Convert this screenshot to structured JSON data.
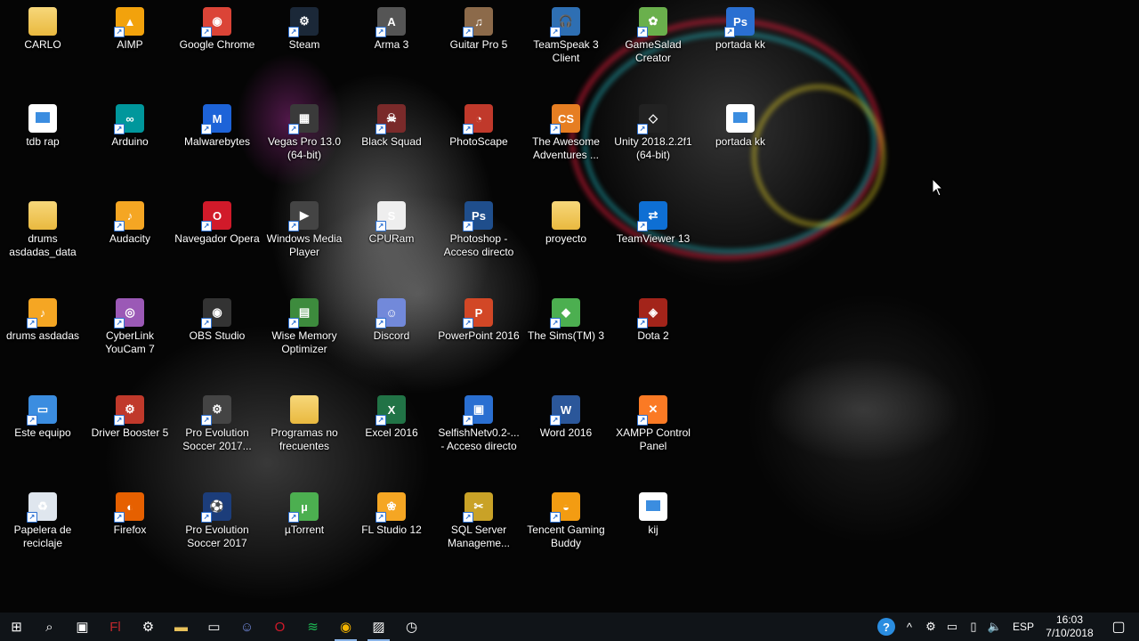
{
  "desktop": {
    "icons": [
      {
        "label": "CARLO",
        "name": "carlo-folder-icon",
        "color": "#e8c15a",
        "kind": "folder"
      },
      {
        "label": "AIMP",
        "name": "aimp-icon",
        "color": "#f2a20c",
        "kind": "app",
        "glyph": "▲"
      },
      {
        "label": "Google Chrome",
        "name": "google-chrome-icon",
        "color": "#db4437",
        "kind": "app",
        "glyph": "◉"
      },
      {
        "label": "Steam",
        "name": "steam-icon",
        "color": "#1b2838",
        "kind": "app",
        "glyph": "⚙"
      },
      {
        "label": "Arma 3",
        "name": "arma-3-icon",
        "color": "#555555",
        "kind": "app",
        "glyph": "A"
      },
      {
        "label": "Guitar Pro 5",
        "name": "guitar-pro-5-icon",
        "color": "#8c6a4a",
        "kind": "app",
        "glyph": "♫"
      },
      {
        "label": "TeamSpeak 3 Client",
        "name": "teamspeak-3-client-icon",
        "color": "#2e6fb3",
        "kind": "app",
        "glyph": "🎧"
      },
      {
        "label": "GameSalad Creator",
        "name": "gamesalad-creator-icon",
        "color": "#6ab04c",
        "kind": "app",
        "glyph": "✿"
      },
      {
        "label": "portada kk",
        "name": "portada-kk-psd-icon",
        "color": "#2a6fd1",
        "kind": "app",
        "glyph": "Ps"
      },
      {
        "label": "tdb rap",
        "name": "tdb-rap-file-icon",
        "color": "#ffffff",
        "kind": "file"
      },
      {
        "label": "Arduino",
        "name": "arduino-icon",
        "color": "#00979c",
        "kind": "app",
        "glyph": "∞"
      },
      {
        "label": "Malwarebytes",
        "name": "malwarebytes-icon",
        "color": "#1d63d8",
        "kind": "app",
        "glyph": "M"
      },
      {
        "label": "Vegas Pro 13.0\n(64-bit)",
        "name": "vegas-pro-icon",
        "color": "#3a3a3a",
        "kind": "app",
        "glyph": "▦"
      },
      {
        "label": "Black Squad",
        "name": "black-squad-icon",
        "color": "#7a2a2a",
        "kind": "app",
        "glyph": "☠"
      },
      {
        "label": "PhotoScape",
        "name": "photoscape-icon",
        "color": "#c0392b",
        "kind": "app",
        "glyph": "◔"
      },
      {
        "label": "The Awesome\nAdventures ...",
        "name": "awesome-adventures-icon",
        "color": "#e67e22",
        "kind": "app",
        "glyph": "CS"
      },
      {
        "label": "Unity 2018.2.2f1\n(64-bit)",
        "name": "unity-icon",
        "color": "#222222",
        "kind": "app",
        "glyph": "◇"
      },
      {
        "label": "portada kk",
        "name": "portada-kk-image-icon",
        "color": "#ffffff",
        "kind": "file"
      },
      {
        "label": "drums\nasdadas_data",
        "name": "drums-asdadas-data-folder-icon",
        "color": "#e8c15a",
        "kind": "folder"
      },
      {
        "label": "Audacity",
        "name": "audacity-icon",
        "color": "#f5a623",
        "kind": "app",
        "glyph": "♪"
      },
      {
        "label": "Navegador Opera",
        "name": "opera-icon",
        "color": "#d11a2a",
        "kind": "app",
        "glyph": "O"
      },
      {
        "label": "Windows Media\nPlayer",
        "name": "windows-media-player-icon",
        "color": "#444444",
        "kind": "app",
        "glyph": "▶"
      },
      {
        "label": "CPURam",
        "name": "cpuram-icon",
        "color": "#eeeeee",
        "kind": "app",
        "glyph": "S"
      },
      {
        "label": "Photoshop -\nAcceso directo",
        "name": "photoshop-icon",
        "color": "#1f4e8c",
        "kind": "app",
        "glyph": "Ps"
      },
      {
        "label": "proyecto",
        "name": "proyecto-folder-icon",
        "color": "#e8c15a",
        "kind": "folder"
      },
      {
        "label": "TeamViewer 13",
        "name": "teamviewer-icon",
        "color": "#0e6fd4",
        "kind": "app",
        "glyph": "⇄"
      },
      {
        "label": "drums asdadas",
        "name": "drums-asdadas-icon",
        "color": "#f5a623",
        "kind": "app",
        "glyph": "♪"
      },
      {
        "label": "CyberLink\nYouCam 7",
        "name": "cyberlink-youcam-icon",
        "color": "#9b59b6",
        "kind": "app",
        "glyph": "◎"
      },
      {
        "label": "OBS Studio",
        "name": "obs-studio-icon",
        "color": "#333333",
        "kind": "app",
        "glyph": "◉"
      },
      {
        "label": "Wise Memory\nOptimizer",
        "name": "wise-memory-optimizer-icon",
        "color": "#3d8b3d",
        "kind": "app",
        "glyph": "▤"
      },
      {
        "label": "Discord",
        "name": "discord-icon",
        "color": "#7289da",
        "kind": "app",
        "glyph": "☺"
      },
      {
        "label": "PowerPoint 2016",
        "name": "powerpoint-icon",
        "color": "#d24726",
        "kind": "app",
        "glyph": "P"
      },
      {
        "label": "The Sims(TM) 3",
        "name": "the-sims-3-icon",
        "color": "#4caf50",
        "kind": "app",
        "glyph": "◆"
      },
      {
        "label": "Dota 2",
        "name": "dota-2-icon",
        "color": "#a3241a",
        "kind": "app",
        "glyph": "◈"
      },
      {
        "label": "Este equipo",
        "name": "este-equipo-icon",
        "color": "#3b8de0",
        "kind": "app",
        "glyph": "▭"
      },
      {
        "label": "Driver Booster 5",
        "name": "driver-booster-icon",
        "color": "#c0392b",
        "kind": "app",
        "glyph": "⚙"
      },
      {
        "label": "Pro Evolution\nSoccer 2017...",
        "name": "pes-2017-settings-icon",
        "color": "#444444",
        "kind": "app",
        "glyph": "⚙"
      },
      {
        "label": "Programas no\nfrecuentes",
        "name": "programas-no-frecuentes-folder-icon",
        "color": "#e8c15a",
        "kind": "folder"
      },
      {
        "label": "Excel 2016",
        "name": "excel-icon",
        "color": "#217346",
        "kind": "app",
        "glyph": "X"
      },
      {
        "label": "SelfishNetv0.2-...\n- Acceso directo",
        "name": "selfishnet-icon",
        "color": "#2a6fd1",
        "kind": "app",
        "glyph": "▣"
      },
      {
        "label": "Word 2016",
        "name": "word-icon",
        "color": "#2b579a",
        "kind": "app",
        "glyph": "W"
      },
      {
        "label": "XAMPP Control\nPanel",
        "name": "xampp-control-panel-icon",
        "color": "#fb7a24",
        "kind": "app",
        "glyph": "✕"
      },
      {
        "label": "Papelera de\nreciclaje",
        "name": "recycle-bin-icon",
        "color": "#dfe6ee",
        "kind": "app",
        "glyph": "♻"
      },
      {
        "label": "Firefox",
        "name": "firefox-icon",
        "color": "#e66000",
        "kind": "app",
        "glyph": "◐"
      },
      {
        "label": "Pro Evolution\nSoccer 2017",
        "name": "pes-2017-icon",
        "color": "#1c3d7a",
        "kind": "app",
        "glyph": "⚽"
      },
      {
        "label": "µTorrent",
        "name": "utorrent-icon",
        "color": "#4caf50",
        "kind": "app",
        "glyph": "µ"
      },
      {
        "label": "FL Studio 12",
        "name": "fl-studio-icon",
        "color": "#f5a623",
        "kind": "app",
        "glyph": "❀"
      },
      {
        "label": "SQL Server\nManageme...",
        "name": "sql-server-management-icon",
        "color": "#c9a227",
        "kind": "app",
        "glyph": "✂"
      },
      {
        "label": "Tencent Gaming\nBuddy",
        "name": "tencent-gaming-buddy-icon",
        "color": "#f39c12",
        "kind": "app",
        "glyph": "◒"
      },
      {
        "label": "kij",
        "name": "kij-file-icon",
        "color": "#ffffff",
        "kind": "file"
      }
    ]
  },
  "taskbar": {
    "buttons": [
      {
        "name": "start-button",
        "icon": "windows-logo-icon",
        "glyph": "⊞",
        "running": false
      },
      {
        "name": "search-button",
        "icon": "search-icon",
        "glyph": "⌕",
        "running": false
      },
      {
        "name": "task-view-button",
        "icon": "task-view-icon",
        "glyph": "▣",
        "running": false
      },
      {
        "name": "flash-taskbar-button",
        "icon": "flash-icon",
        "glyph": "Fl",
        "running": false,
        "color": "#c0272d"
      },
      {
        "name": "steam-taskbar-button",
        "icon": "steam-icon",
        "glyph": "⚙",
        "running": false
      },
      {
        "name": "file-explorer-taskbar-button",
        "icon": "folder-icon",
        "glyph": "▬",
        "running": false,
        "color": "#e8c15a"
      },
      {
        "name": "window-taskbar-button",
        "icon": "window-icon",
        "glyph": "▭",
        "running": false
      },
      {
        "name": "discord-taskbar-button",
        "icon": "discord-icon",
        "glyph": "☺",
        "running": false,
        "color": "#7289da"
      },
      {
        "name": "opera-taskbar-button",
        "icon": "opera-icon",
        "glyph": "O",
        "running": false,
        "color": "#d11a2a"
      },
      {
        "name": "spotify-taskbar-button",
        "icon": "spotify-icon",
        "glyph": "≋",
        "running": false,
        "color": "#1db954"
      },
      {
        "name": "chrome-taskbar-button",
        "icon": "chrome-icon",
        "glyph": "◉",
        "running": true,
        "color": "#f4b400"
      },
      {
        "name": "photos-taskbar-button",
        "icon": "photos-icon",
        "glyph": "▨",
        "running": true
      },
      {
        "name": "clock-app-taskbar-button",
        "icon": "clock-icon",
        "glyph": "◷",
        "running": false
      }
    ],
    "tray": [
      {
        "name": "help-tray-icon",
        "glyph": "?",
        "color": "#2a8de0"
      },
      {
        "name": "show-hidden-icons-icon",
        "glyph": "^"
      },
      {
        "name": "steam-tray-icon",
        "glyph": "⚙"
      },
      {
        "name": "network-tray-icon",
        "glyph": "▭"
      },
      {
        "name": "battery-tray-icon",
        "glyph": "▯"
      },
      {
        "name": "volume-tray-icon",
        "glyph": "🔈"
      }
    ],
    "language": "ESP",
    "time": "16:03",
    "date": "7/10/2018",
    "notification_glyph": "▢"
  }
}
